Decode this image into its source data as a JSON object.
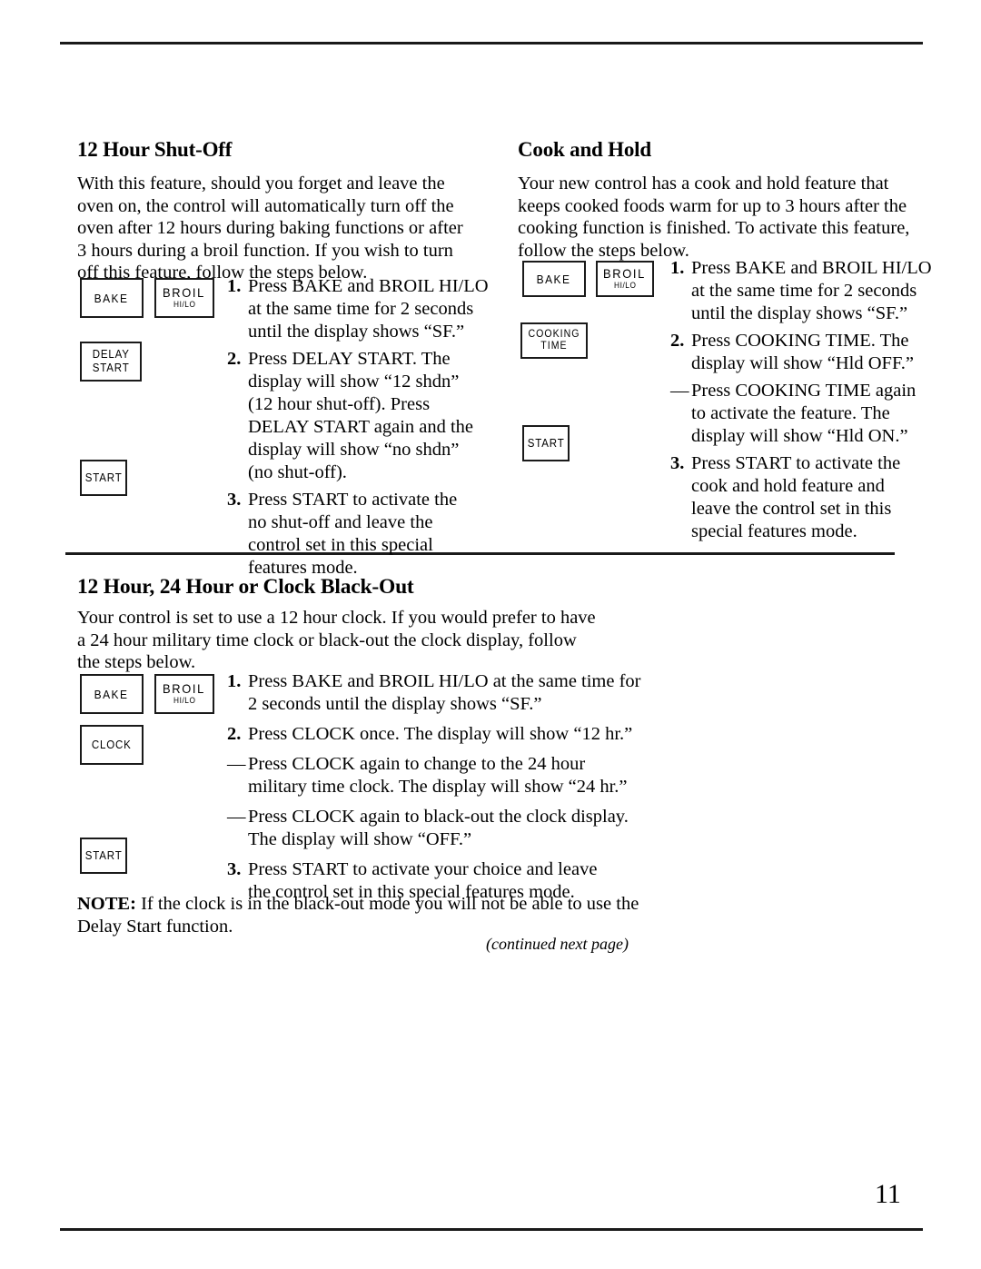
{
  "document": {
    "page_number": "11",
    "continued_note": "(continued next page)"
  },
  "sections": {
    "shut_off": {
      "heading": "12 Hour Shut-Off",
      "intro": [
        "With this feature, should you forget and leave the",
        "oven on, the control will automatically turn off the",
        "oven after 12 hours during baking functions or after",
        "3 hours during a broil function. If you wish to turn",
        "off this feature, follow the steps below."
      ],
      "steps": [
        {
          "marker": "1.",
          "lines": [
            "Press BAKE and BROIL HI/LO",
            "at the same time for 2 seconds",
            "until the display shows “SF.”"
          ]
        },
        {
          "marker": "2.",
          "lines": [
            "Press DELAY START. The",
            "display will show “12 shdn”",
            "(12 hour shut-off). Press",
            "DELAY START again and the",
            "display will show “no shdn”",
            "(no shut-off)."
          ]
        },
        {
          "marker": "3.",
          "lines": [
            "Press START to activate the",
            "no shut-off and leave the",
            "control set in this special",
            "features mode."
          ]
        }
      ],
      "buttons": {
        "bake": {
          "line1": "BAKE",
          "line2": ""
        },
        "broil": {
          "line1": "BROIL",
          "line2": "HI/LO"
        },
        "delay_start": {
          "line1": "DELAY",
          "line2": "START"
        },
        "start": {
          "line1": "START",
          "line2": ""
        }
      }
    },
    "cook_and_hold": {
      "heading": "Cook and Hold",
      "intro": [
        "Your new control has a cook and hold feature that",
        "keeps cooked foods warm for up to 3 hours after the",
        "cooking function is finished. To activate this feature,",
        "follow the steps below."
      ],
      "steps": [
        {
          "marker": "1.",
          "lines": [
            "Press BAKE and BROIL HI/LO",
            "at the same time for 2 seconds",
            "until the display shows “SF.”"
          ]
        },
        {
          "marker": "2.",
          "lines": [
            "Press COOKING TIME. The",
            "display will show “Hld OFF.”"
          ]
        },
        {
          "marker": "—",
          "lines": [
            "Press COOKING TIME again",
            "to activate the feature. The",
            "display will show “Hld ON.”"
          ]
        },
        {
          "marker": "3.",
          "lines": [
            "Press START to activate the",
            "cook and hold feature and",
            "leave the control set in this",
            "special features mode."
          ]
        }
      ],
      "buttons": {
        "bake": {
          "line1": "BAKE",
          "line2": ""
        },
        "broil": {
          "line1": "BROIL",
          "line2": "HI/LO"
        },
        "cooking_time": {
          "line1": "COOKING",
          "line2": "TIME"
        },
        "start": {
          "line1": "START",
          "line2": ""
        }
      }
    },
    "clock_blackout": {
      "heading": "12 Hour, 24 Hour or Clock Black-Out",
      "intro": [
        "Your control is set to use a 12 hour clock. If you would prefer to have",
        "a 24 hour military time clock or black-out the clock display, follow",
        "the steps below."
      ],
      "steps": [
        {
          "marker": "1.",
          "lines": [
            "Press BAKE and BROIL HI/LO at the same time for",
            "2 seconds until the display shows “SF.”"
          ]
        },
        {
          "marker": "2.",
          "lines": [
            "Press CLOCK once. The display will show “12 hr.”"
          ]
        },
        {
          "marker": "—",
          "lines": [
            "Press CLOCK again to change to the 24 hour",
            "military time clock. The display will show “24 hr.”"
          ]
        },
        {
          "marker": "—",
          "lines": [
            "Press CLOCK again to black-out the clock display.",
            "The display will show “OFF.”"
          ]
        },
        {
          "marker": "3.",
          "lines": [
            "Press START to activate your choice and leave",
            "the control set in this special features mode."
          ]
        }
      ],
      "buttons": {
        "bake": {
          "line1": "BAKE",
          "line2": ""
        },
        "broil": {
          "line1": "BROIL",
          "line2": "HI/LO"
        },
        "clock": {
          "line1": "CLOCK",
          "line2": ""
        },
        "start": {
          "line1": "START",
          "line2": ""
        }
      },
      "note": {
        "label": "NOTE:",
        "lines": [
          " If the clock is in the black-out mode you will not be able to use the",
          "Delay Start function."
        ]
      }
    }
  }
}
